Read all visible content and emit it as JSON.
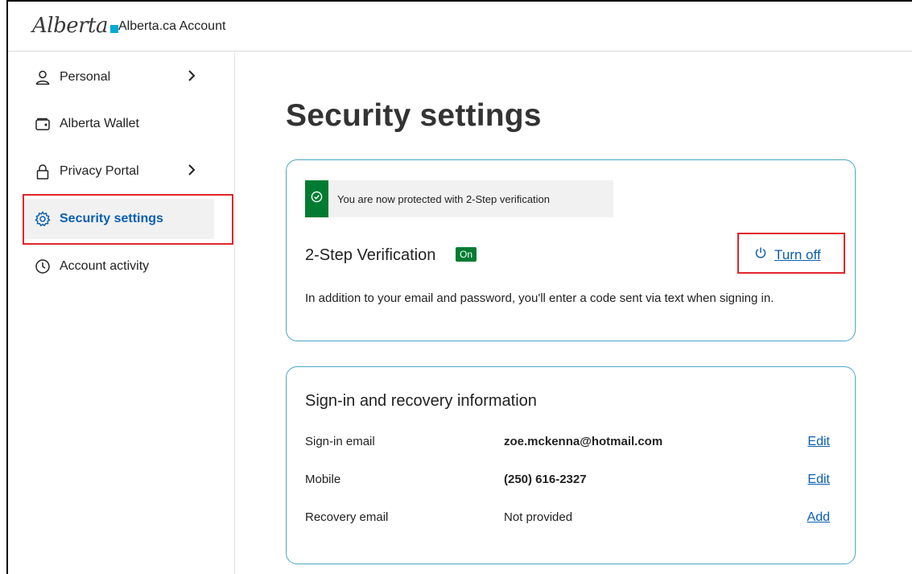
{
  "header": {
    "logo_text": "Alberta",
    "app_title": "Alberta.ca Account"
  },
  "sidebar": {
    "items": [
      {
        "label": "Personal",
        "icon": "person-icon",
        "has_chevron": true
      },
      {
        "label": "Alberta Wallet",
        "icon": "wallet-icon",
        "has_chevron": false
      },
      {
        "label": "Privacy Portal",
        "icon": "lock-icon",
        "has_chevron": true
      },
      {
        "label": "Security settings",
        "icon": "gear-icon",
        "active": true
      },
      {
        "label": "Account activity",
        "icon": "clock-icon",
        "has_chevron": false
      }
    ]
  },
  "main": {
    "page_title": "Security settings",
    "two_step": {
      "banner_text": "You are now protected with 2-Step verification",
      "title": "2-Step Verification",
      "status_badge": "On",
      "action_label": "Turn off",
      "description": "In addition to your email and password, you'll enter a code sent via text when signing in."
    },
    "signin_recovery": {
      "title": "Sign-in and recovery information",
      "rows": [
        {
          "label": "Sign-in email",
          "value": "zoe.mckenna@hotmail.com",
          "action": "Edit"
        },
        {
          "label": "Mobile",
          "value": "(250) 616-2327",
          "action": "Edit"
        },
        {
          "label": "Recovery email",
          "value": "Not provided",
          "action": "Add"
        }
      ]
    }
  },
  "colors": {
    "accent_link": "#0b5fb2",
    "success_green": "#007c32",
    "card_border": "#4ba6c4",
    "highlight_red": "#e0262a"
  }
}
